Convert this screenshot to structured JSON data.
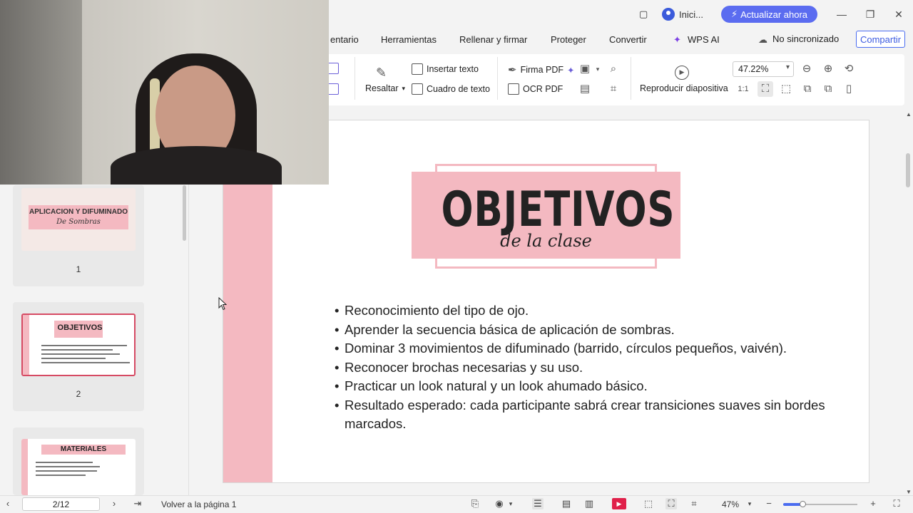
{
  "titlebar": {
    "account_label": "Inici...",
    "upgrade_label": "Actualizar ahora",
    "window_controls": [
      "minimize-icon",
      "restore-icon",
      "close-icon"
    ]
  },
  "menubar": {
    "items": [
      "entario",
      "Herramientas",
      "Rellenar y firmar",
      "Proteger",
      "Convertir",
      "WPS AI"
    ],
    "sync_status": "No sincronizado",
    "share_label": "Compartir"
  },
  "ribbon": {
    "highlight_label": "Resaltar",
    "insert_text_label": "Insertar texto",
    "text_box_label": "Cuadro de texto",
    "pdf_sign_label": "Firma PDF",
    "ocr_label": "OCR PDF",
    "slideshow_label": "Reproducir diapositiva",
    "zoom_value": "47.22%"
  },
  "sidebar": {
    "thumbnails": [
      {
        "number": "1",
        "title": "APLICACION Y DIFUMINADO",
        "subtitle": "De Sombras"
      },
      {
        "number": "2",
        "title": "OBJETIVOS"
      },
      {
        "title": "MATERIALES"
      }
    ]
  },
  "slide": {
    "title": "OBJETIVOS",
    "subtitle": "de la clase",
    "bullets": [
      "Reconocimiento del tipo de ojo.",
      "Aprender la secuencia básica de aplicación de sombras.",
      "Dominar 3 movimientos de difuminado (barrido, círculos pequeños, vaivén).",
      "Reconocer brochas necesarias y su uso.",
      "Practicar un look natural y un look ahumado básico.",
      "Resultado esperado: cada participante sabrá crear transiciones suaves sin bordes marcados."
    ],
    "accent_color": "#f4b9c1"
  },
  "statusbar": {
    "page_value": "2/12",
    "back_to_page_label": "Volver a la página 1",
    "zoom_percent": "47%",
    "zoom_fraction": 0.26
  }
}
